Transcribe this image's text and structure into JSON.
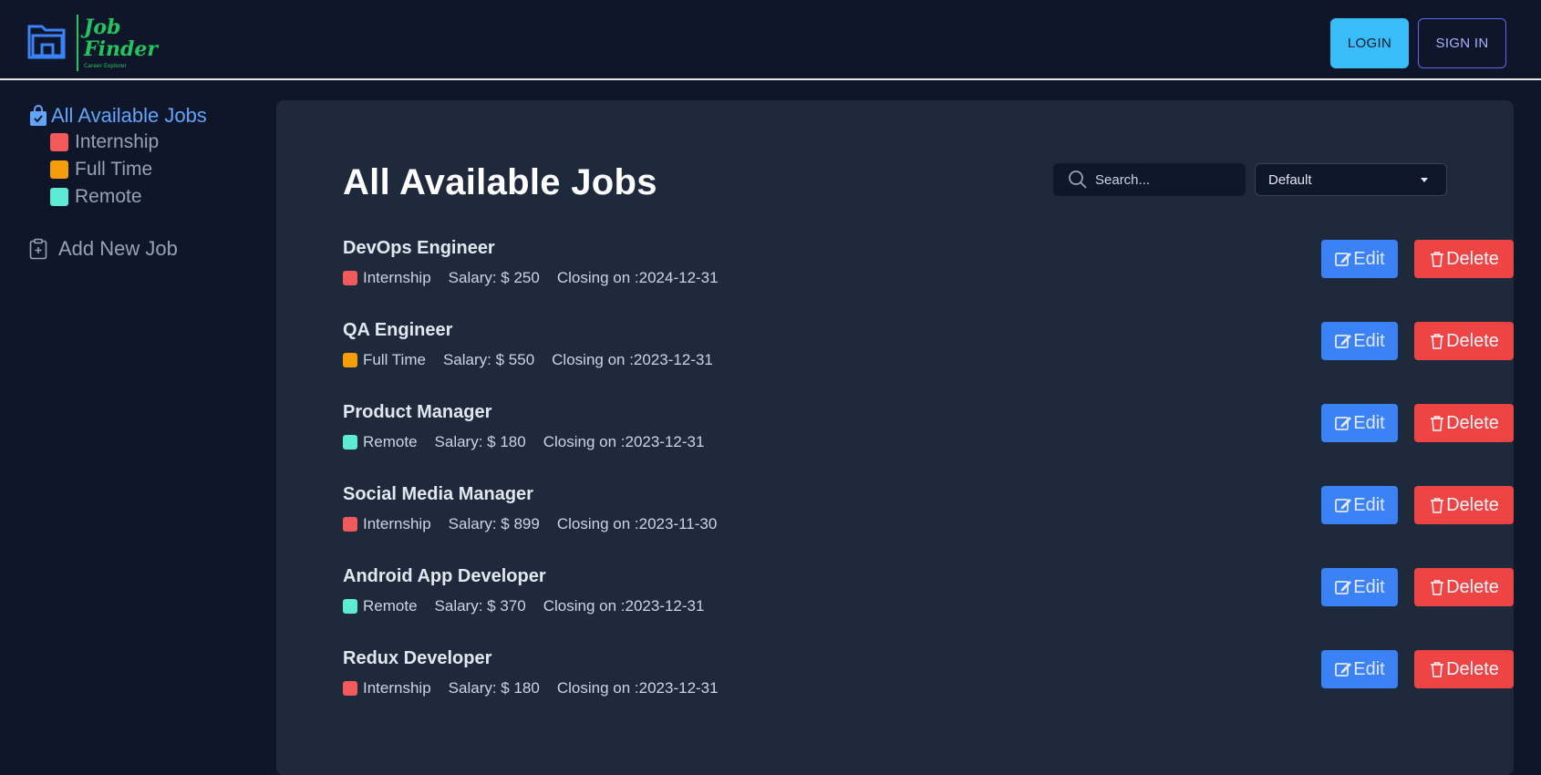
{
  "header": {
    "logo_line1": "Job",
    "logo_line2": "Finder",
    "logo_tagline": "Career Explorer",
    "login_label": "LOGIN",
    "signin_label": "SIGN IN"
  },
  "sidebar": {
    "main_label": "All Available Jobs",
    "filters": [
      {
        "label": "Internship",
        "color": "#f15a5a"
      },
      {
        "label": "Full Time",
        "color": "#f59e0b"
      },
      {
        "label": "Remote",
        "color": "#5eead4"
      }
    ],
    "add_label": "Add New Job"
  },
  "main": {
    "title": "All Available Jobs",
    "search_placeholder": "Search...",
    "sort_selected": "Default",
    "edit_label": "Edit",
    "delete_label": "Delete",
    "jobs": [
      {
        "title": "DevOps Engineer",
        "type": "Internship",
        "salary": "Salary: $ 250",
        "closing": "Closing on :2024-12-31",
        "color": "#f15a5a"
      },
      {
        "title": "QA Engineer",
        "type": "Full Time",
        "salary": "Salary: $ 550",
        "closing": "Closing on :2023-12-31",
        "color": "#f59e0b"
      },
      {
        "title": "Product Manager",
        "type": "Remote",
        "salary": "Salary: $ 180",
        "closing": "Closing on :2023-12-31",
        "color": "#5eead4"
      },
      {
        "title": "Social Media Manager",
        "type": "Internship",
        "salary": "Salary: $ 899",
        "closing": "Closing on :2023-11-30",
        "color": "#f15a5a"
      },
      {
        "title": "Android App Developer",
        "type": "Remote",
        "salary": "Salary: $ 370",
        "closing": "Closing on :2023-12-31",
        "color": "#5eead4"
      },
      {
        "title": "Redux Developer",
        "type": "Internship",
        "salary": "Salary: $ 180",
        "closing": "Closing on :2023-12-31",
        "color": "#f15a5a"
      }
    ]
  },
  "colors": {
    "accent_blue": "#3b82f6",
    "danger_red": "#ef4444",
    "login_bg": "#38bdf8",
    "logo_green": "#22c55e"
  }
}
